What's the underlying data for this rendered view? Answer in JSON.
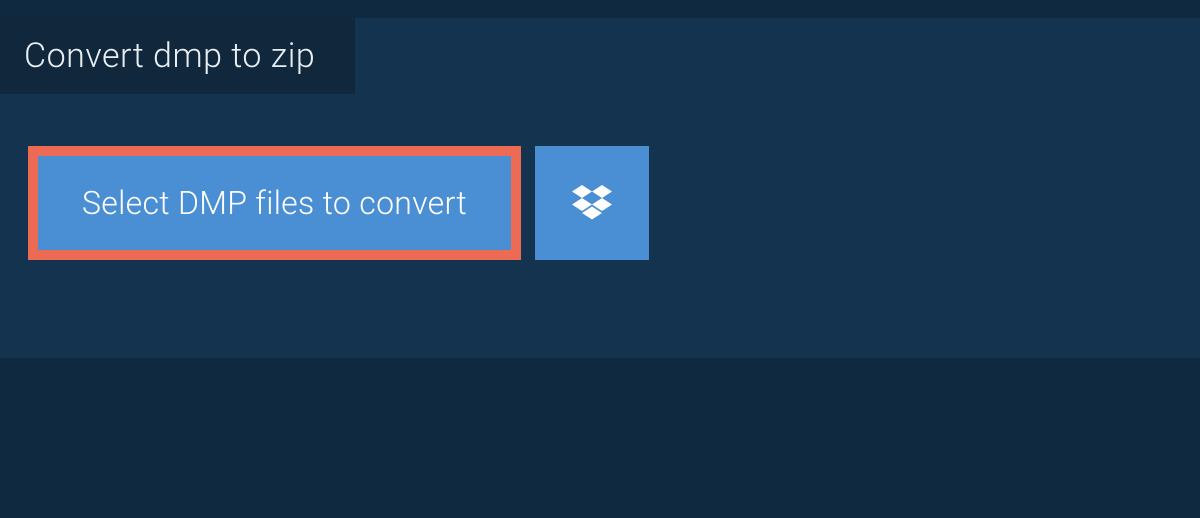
{
  "tab": {
    "title": "Convert dmp to zip"
  },
  "actions": {
    "select_label": "Select DMP files to convert"
  },
  "colors": {
    "page_bg": "#0f2940",
    "panel_bg": "#14334e",
    "tab_bg": "#11283c",
    "button_bg": "#4a8fd4",
    "highlight_border": "#ed6a55",
    "text_light": "#e8eef4"
  }
}
